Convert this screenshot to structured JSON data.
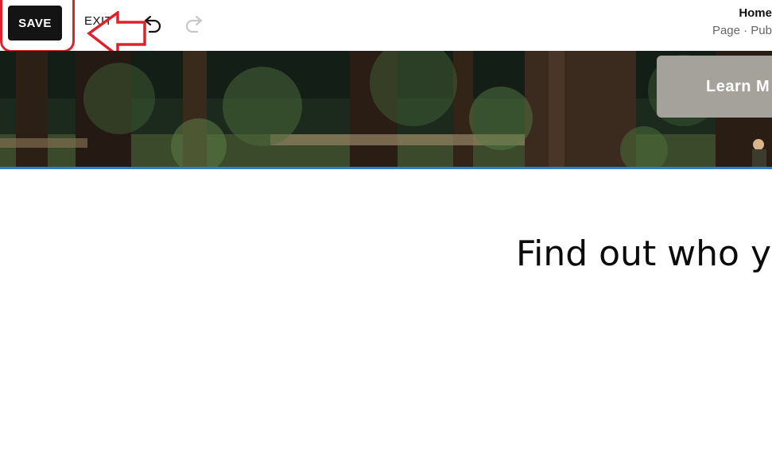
{
  "toolbar": {
    "save_label": "SAVE",
    "exit_label": "EXIT",
    "undo_icon": "undo-icon",
    "redo_icon": "redo-icon"
  },
  "page_info": {
    "title": "Home",
    "meta": "Page · Pub"
  },
  "hero": {
    "button_label": "Learn M"
  },
  "main": {
    "headline": "Find out who y"
  },
  "colors": {
    "save_bg": "#141414",
    "annotation_red": "#e0202a",
    "selection_blue": "#2f7bd6",
    "button_gray": "#a5a29c"
  }
}
